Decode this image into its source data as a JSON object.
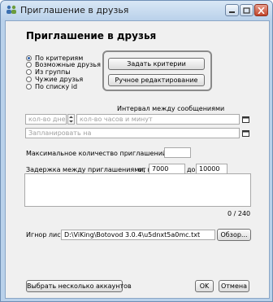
{
  "window": {
    "title": "Приглашение в друзья"
  },
  "heading": "Приглашение в друзья",
  "source_options": [
    {
      "label": "По критериям",
      "selected": true
    },
    {
      "label": "Возможные друзья",
      "selected": false
    },
    {
      "label": "Из группы",
      "selected": false
    },
    {
      "label": "Чужие друзья",
      "selected": false
    },
    {
      "label": "По списку id",
      "selected": false
    }
  ],
  "criteria": {
    "set_button": "Задать критерии",
    "manual_button": "Ручное редактирование"
  },
  "interval": {
    "label": "Интервал между сообщениями",
    "days_placeholder": "кол-во дней",
    "time_placeholder": "кол-во часов и минут",
    "schedule_placeholder": "Запланировать на"
  },
  "max_invites": {
    "label": "Максимальное количество приглашений",
    "value": ""
  },
  "delay": {
    "label": "Задержка между приглашениями, мс",
    "from_label": "от",
    "from_value": "7000",
    "to_label": "до",
    "to_value": "10000"
  },
  "message": {
    "counter": "0 / 240"
  },
  "ignore": {
    "label": "Игнор лист",
    "path": "D:\\ViKing\\Botovod 3.0.4\\u5dnxt5a0mc.txt",
    "browse_button": "Обзор..."
  },
  "footer": {
    "accounts_button": "Выбрать несколько аккаунтов",
    "ok_button": "OK",
    "cancel_button": "Отмена"
  }
}
